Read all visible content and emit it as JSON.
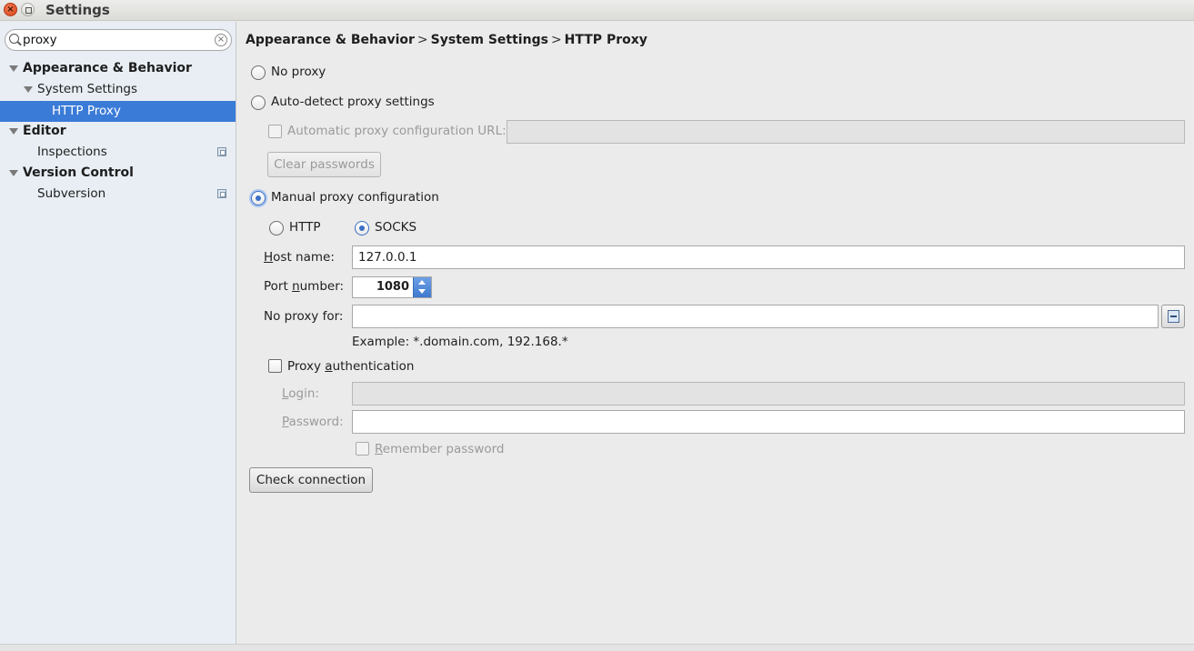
{
  "window": {
    "title": "Settings"
  },
  "search": {
    "value": "proxy"
  },
  "tree": {
    "appearance": "Appearance & Behavior",
    "system_settings": "System Settings",
    "http_proxy": "HTTP Proxy",
    "editor": "Editor",
    "inspections": "Inspections",
    "version_control": "Version Control",
    "subversion": "Subversion"
  },
  "breadcrumb": {
    "part1": "Appearance & Behavior",
    "sep": ">",
    "part2": "System Settings",
    "part3": "HTTP Proxy"
  },
  "options": {
    "no_proxy": "No proxy",
    "auto_detect": "Auto-detect proxy settings",
    "auto_config_url_label": "Automatic proxy configuration URL:",
    "auto_config_url_value": "",
    "clear_passwords": "Clear passwords",
    "manual": "Manual proxy configuration",
    "selected_mode": "Manual proxy configuration"
  },
  "manual": {
    "http": "HTTP",
    "socks": "SOCKS",
    "selected_type": "SOCKS",
    "host_label_u": "H",
    "host_label_rest": "ost name:",
    "host_value": "127.0.0.1",
    "port_label_pre": "Port ",
    "port_label_u": "n",
    "port_label_rest": "umber:",
    "port_value": "1080",
    "no_proxy_label": "No proxy for:",
    "no_proxy_value": "",
    "example": "Example: *.domain.com, 192.168.*",
    "auth_pre": "Proxy ",
    "auth_u": "a",
    "auth_rest": "uthentication",
    "auth_checked": false,
    "login_u": "L",
    "login_rest": "ogin:",
    "login_value": "",
    "password_u": "P",
    "password_rest": "assword:",
    "password_value": "",
    "remember_u": "R",
    "remember_rest": "emember password"
  },
  "check_connection": "Check connection",
  "colors": {
    "selection": "#3b7bd8",
    "radio_accent": "#3a6fc3"
  }
}
